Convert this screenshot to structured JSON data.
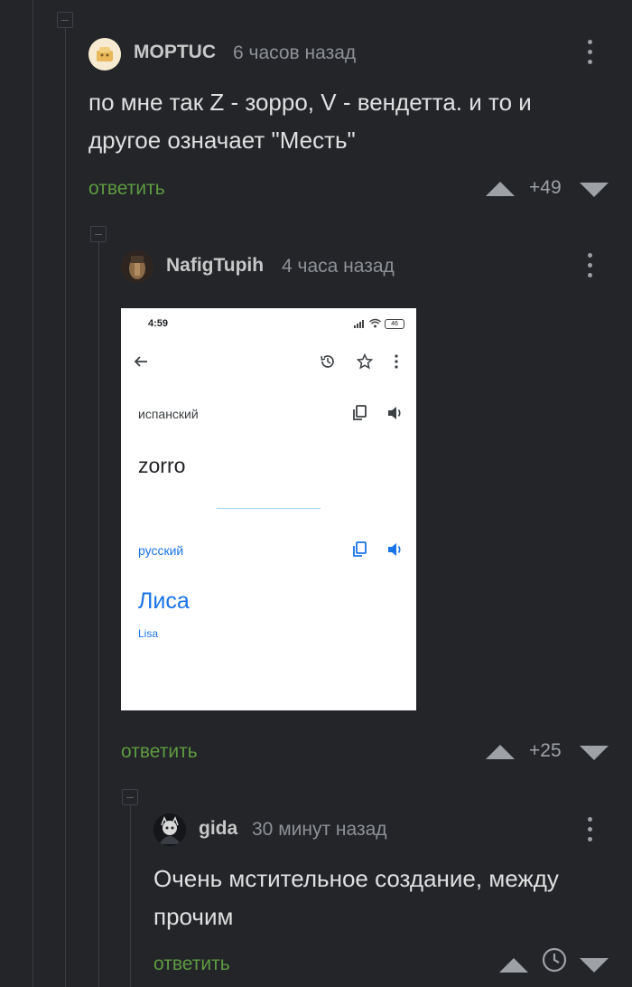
{
  "comments": [
    {
      "username": "MOPTUC",
      "time": "6 часов назад",
      "text": "по мне так Z - зорро, V - вендетта. и то и другое означает \"Месть\"",
      "reply_label": "ответить",
      "rating": "+49"
    },
    {
      "username": "NafigTupih",
      "time": "4 часа назад",
      "reply_label": "ответить",
      "rating": "+25",
      "image": {
        "status_time": "4:59",
        "battery": "46",
        "source_lang": "испанский",
        "source_text": "zorro",
        "target_lang": "русский",
        "target_text": "Лиса",
        "transliteration": "Lisa"
      }
    },
    {
      "username": "gida",
      "time": "30 минут назад",
      "text": "Очень мстительное создание, между прочим",
      "reply_label": "ответить"
    }
  ],
  "colors": {
    "background": "#232529",
    "reply": "#5e9a40",
    "translate_blue": "#1a73e8"
  },
  "icons": [
    "collapse-icon",
    "kebab-menu-icon",
    "upvote-icon",
    "downvote-icon",
    "clock-icon",
    "back-arrow-icon",
    "history-icon",
    "star-icon",
    "copy-icon",
    "speaker-icon",
    "signal-icon",
    "wifi-icon",
    "battery-icon"
  ]
}
